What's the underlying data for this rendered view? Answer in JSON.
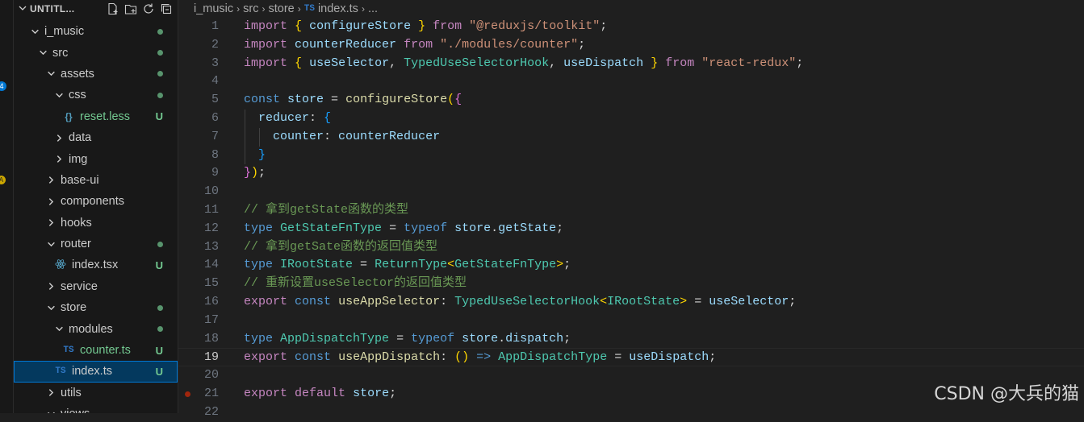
{
  "explorer": {
    "title": "UNTITL...",
    "actions": [
      "new-file-icon",
      "new-folder-icon",
      "refresh-icon",
      "collapse-all-icon"
    ],
    "tree": [
      {
        "label": "i_music",
        "depth": 1,
        "kind": "folder",
        "open": true,
        "status": "dot"
      },
      {
        "label": "src",
        "depth": 2,
        "kind": "folder",
        "open": true,
        "status": "dot"
      },
      {
        "label": "assets",
        "depth": 3,
        "kind": "folder",
        "open": true,
        "status": "dot"
      },
      {
        "label": "css",
        "depth": 4,
        "kind": "folder",
        "open": true,
        "status": "dot"
      },
      {
        "label": "reset.less",
        "depth": 5,
        "kind": "less",
        "status": "U",
        "modified": true
      },
      {
        "label": "data",
        "depth": 4,
        "kind": "folder",
        "open": false
      },
      {
        "label": "img",
        "depth": 4,
        "kind": "folder",
        "open": false
      },
      {
        "label": "base-ui",
        "depth": 3,
        "kind": "folder",
        "open": false
      },
      {
        "label": "components",
        "depth": 3,
        "kind": "folder",
        "open": false
      },
      {
        "label": "hooks",
        "depth": 3,
        "kind": "folder",
        "open": false
      },
      {
        "label": "router",
        "depth": 3,
        "kind": "folder",
        "open": true,
        "status": "dot"
      },
      {
        "label": "index.tsx",
        "depth": 4,
        "kind": "react",
        "status": "U",
        "modified": false
      },
      {
        "label": "service",
        "depth": 3,
        "kind": "folder",
        "open": false
      },
      {
        "label": "store",
        "depth": 3,
        "kind": "folder",
        "open": true,
        "status": "dot"
      },
      {
        "label": "modules",
        "depth": 4,
        "kind": "folder",
        "open": true,
        "status": "dot"
      },
      {
        "label": "counter.ts",
        "depth": 5,
        "kind": "ts",
        "status": "U",
        "modified": true
      },
      {
        "label": "index.ts",
        "depth": 4,
        "kind": "ts",
        "status": "U",
        "modified": false,
        "selected": true
      },
      {
        "label": "utils",
        "depth": 3,
        "kind": "folder",
        "open": false
      },
      {
        "label": "views",
        "depth": 3,
        "kind": "folder",
        "open": true
      }
    ]
  },
  "activity": {
    "badge_count": "4",
    "warning_badge": "A"
  },
  "breadcrumb": {
    "items": [
      "i_music",
      "src",
      "store"
    ],
    "file_badge": "TS",
    "file": "index.ts",
    "more": "..."
  },
  "editor": {
    "current_line": 19,
    "breakpoint_line": 21,
    "lines": [
      {
        "n": "1",
        "t": [
          [
            "kw",
            "import"
          ],
          [
            "p",
            " "
          ],
          [
            "br1",
            "{"
          ],
          [
            "p",
            " "
          ],
          [
            "id",
            "configureStore"
          ],
          [
            "p",
            " "
          ],
          [
            "br1",
            "}"
          ],
          [
            "p",
            " "
          ],
          [
            "kw",
            "from"
          ],
          [
            "p",
            " "
          ],
          [
            "str",
            "\"@reduxjs/toolkit\""
          ],
          [
            "p",
            ";"
          ]
        ]
      },
      {
        "n": "2",
        "t": [
          [
            "kw",
            "import"
          ],
          [
            "p",
            " "
          ],
          [
            "id",
            "counterReducer"
          ],
          [
            "p",
            " "
          ],
          [
            "kw",
            "from"
          ],
          [
            "p",
            " "
          ],
          [
            "str",
            "\"./modules/counter\""
          ],
          [
            "p",
            ";"
          ]
        ]
      },
      {
        "n": "3",
        "t": [
          [
            "kw",
            "import"
          ],
          [
            "p",
            " "
          ],
          [
            "br1",
            "{"
          ],
          [
            "p",
            " "
          ],
          [
            "id",
            "useSelector"
          ],
          [
            "p",
            ", "
          ],
          [
            "type",
            "TypedUseSelectorHook"
          ],
          [
            "p",
            ", "
          ],
          [
            "id",
            "useDispatch"
          ],
          [
            "p",
            " "
          ],
          [
            "br1",
            "}"
          ],
          [
            "p",
            " "
          ],
          [
            "kw",
            "from"
          ],
          [
            "p",
            " "
          ],
          [
            "str",
            "\"react-redux\""
          ],
          [
            "p",
            ";"
          ]
        ]
      },
      {
        "n": "4",
        "t": []
      },
      {
        "n": "5",
        "t": [
          [
            "st",
            "const"
          ],
          [
            "p",
            " "
          ],
          [
            "id",
            "store"
          ],
          [
            "p",
            " = "
          ],
          [
            "fn",
            "configureStore"
          ],
          [
            "br1",
            "("
          ],
          [
            "br2",
            "{"
          ]
        ]
      },
      {
        "n": "6",
        "t": [
          [
            "p",
            "  "
          ],
          [
            "id",
            "reducer"
          ],
          [
            "p",
            ": "
          ],
          [
            "br3",
            "{"
          ]
        ]
      },
      {
        "n": "7",
        "t": [
          [
            "p",
            "    "
          ],
          [
            "id",
            "counter"
          ],
          [
            "p",
            ": "
          ],
          [
            "id",
            "counterReducer"
          ]
        ]
      },
      {
        "n": "8",
        "t": [
          [
            "p",
            "  "
          ],
          [
            "br3",
            "}"
          ]
        ]
      },
      {
        "n": "9",
        "t": [
          [
            "br2",
            "}"
          ],
          [
            "br1",
            ")"
          ],
          [
            "p",
            ";"
          ]
        ]
      },
      {
        "n": "10",
        "t": []
      },
      {
        "n": "11",
        "t": [
          [
            "cm",
            "// 拿到getState函数的类型"
          ]
        ]
      },
      {
        "n": "12",
        "t": [
          [
            "st",
            "type"
          ],
          [
            "p",
            " "
          ],
          [
            "type",
            "GetStateFnType"
          ],
          [
            "p",
            " = "
          ],
          [
            "st",
            "typeof"
          ],
          [
            "p",
            " "
          ],
          [
            "id",
            "store"
          ],
          [
            "p",
            "."
          ],
          [
            "id",
            "getState"
          ],
          [
            "p",
            ";"
          ]
        ]
      },
      {
        "n": "13",
        "t": [
          [
            "cm",
            "// 拿到getSate函数的返回值类型"
          ]
        ]
      },
      {
        "n": "14",
        "t": [
          [
            "st",
            "type"
          ],
          [
            "p",
            " "
          ],
          [
            "type",
            "IRootState"
          ],
          [
            "p",
            " = "
          ],
          [
            "type",
            "ReturnType"
          ],
          [
            "br1",
            "<"
          ],
          [
            "type",
            "GetStateFnType"
          ],
          [
            "br1",
            ">"
          ],
          [
            "p",
            ";"
          ]
        ]
      },
      {
        "n": "15",
        "t": [
          [
            "cm",
            "// 重新设置useSelector的返回值类型"
          ]
        ]
      },
      {
        "n": "16",
        "t": [
          [
            "kw",
            "export"
          ],
          [
            "p",
            " "
          ],
          [
            "st",
            "const"
          ],
          [
            "p",
            " "
          ],
          [
            "fn",
            "useAppSelector"
          ],
          [
            "p",
            ": "
          ],
          [
            "type",
            "TypedUseSelectorHook"
          ],
          [
            "br1",
            "<"
          ],
          [
            "type",
            "IRootState"
          ],
          [
            "br1",
            ">"
          ],
          [
            "p",
            " = "
          ],
          [
            "id",
            "useSelector"
          ],
          [
            "p",
            ";"
          ]
        ]
      },
      {
        "n": "17",
        "t": []
      },
      {
        "n": "18",
        "t": [
          [
            "st",
            "type"
          ],
          [
            "p",
            " "
          ],
          [
            "type",
            "AppDispatchType"
          ],
          [
            "p",
            " = "
          ],
          [
            "st",
            "typeof"
          ],
          [
            "p",
            " "
          ],
          [
            "id",
            "store"
          ],
          [
            "p",
            "."
          ],
          [
            "id",
            "dispatch"
          ],
          [
            "p",
            ";"
          ]
        ]
      },
      {
        "n": "19",
        "t": [
          [
            "kw",
            "export"
          ],
          [
            "p",
            " "
          ],
          [
            "st",
            "const"
          ],
          [
            "p",
            " "
          ],
          [
            "fn",
            "useAppDispatch"
          ],
          [
            "p",
            ": "
          ],
          [
            "br1",
            "()"
          ],
          [
            "p",
            " "
          ],
          [
            "st",
            "=>"
          ],
          [
            "p",
            " "
          ],
          [
            "type",
            "AppDispatchType"
          ],
          [
            "p",
            " = "
          ],
          [
            "id",
            "useDispatch"
          ],
          [
            "p",
            ";"
          ]
        ]
      },
      {
        "n": "20",
        "t": []
      },
      {
        "n": "21",
        "t": [
          [
            "kw",
            "export"
          ],
          [
            "p",
            " "
          ],
          [
            "kw",
            "default"
          ],
          [
            "p",
            " "
          ],
          [
            "id",
            "store"
          ],
          [
            "p",
            ";"
          ]
        ]
      },
      {
        "n": "22",
        "t": []
      }
    ]
  },
  "watermark": "CSDN @大兵的猫"
}
